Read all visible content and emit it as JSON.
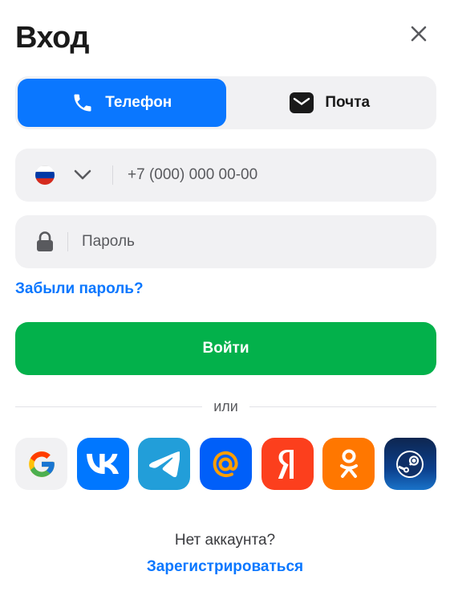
{
  "header": {
    "title": "Вход",
    "close_icon": "close-icon"
  },
  "tabs": [
    {
      "label": "Телефон",
      "icon": "phone-icon",
      "active": true
    },
    {
      "label": "Почта",
      "icon": "envelope-icon",
      "active": false
    }
  ],
  "phone_field": {
    "country": "Russia",
    "placeholder": "+7 (000) 000 00-00",
    "value": ""
  },
  "password_field": {
    "placeholder": "Пароль",
    "value": ""
  },
  "forgot_link": "Забыли пароль?",
  "login_button": "Войти",
  "separator": "или",
  "socials": [
    {
      "name": "google",
      "color": "#f1f1f3"
    },
    {
      "name": "vk",
      "color": "#0077ff"
    },
    {
      "name": "telegram",
      "color": "#229ed9"
    },
    {
      "name": "mail-ru",
      "color": "#005ff9"
    },
    {
      "name": "yandex",
      "color": "#fc3f1d"
    },
    {
      "name": "odnoklassniki",
      "color": "#ff7700"
    },
    {
      "name": "steam",
      "color": "#1b2838"
    }
  ],
  "footer": {
    "question": "Нет аккаунта?",
    "register_link": "Зарегистрироваться"
  },
  "colors": {
    "accent": "#0a77ff",
    "success": "#03b14b",
    "field_bg": "#f1f1f3"
  }
}
